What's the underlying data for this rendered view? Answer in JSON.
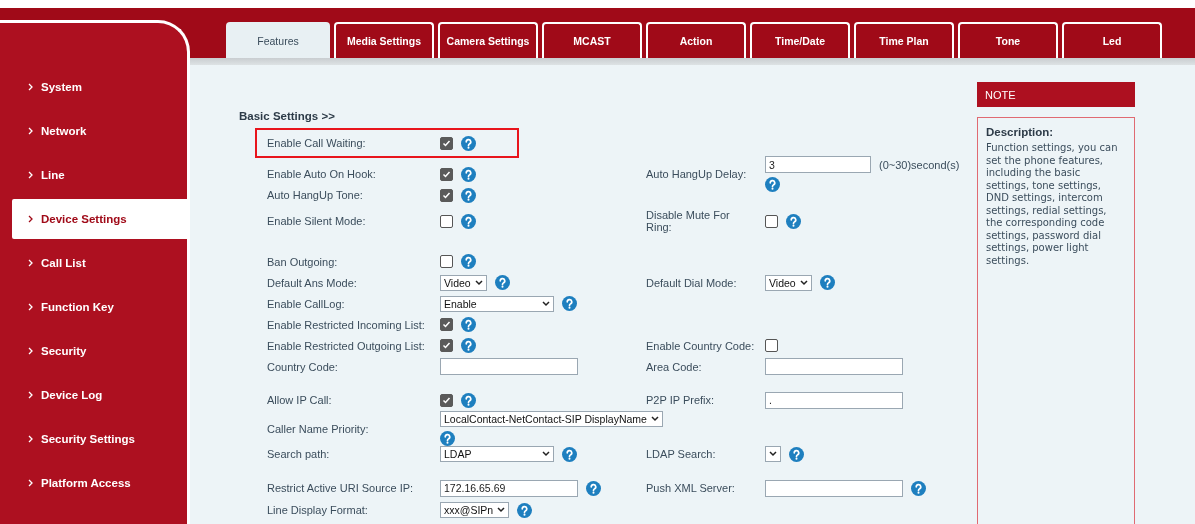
{
  "sidebar": {
    "items": [
      {
        "label": "System",
        "selected": false
      },
      {
        "label": "Network",
        "selected": false
      },
      {
        "label": "Line",
        "selected": false
      },
      {
        "label": "Device Settings",
        "selected": true
      },
      {
        "label": "Call List",
        "selected": false
      },
      {
        "label": "Function Key",
        "selected": false
      },
      {
        "label": "Security",
        "selected": false
      },
      {
        "label": "Device Log",
        "selected": false
      },
      {
        "label": "Security Settings",
        "selected": false
      },
      {
        "label": "Platform Access",
        "selected": false
      }
    ]
  },
  "tabs": [
    {
      "label": "Features",
      "selected": true
    },
    {
      "label": "Media Settings",
      "selected": false
    },
    {
      "label": "Camera Settings",
      "selected": false
    },
    {
      "label": "MCAST",
      "selected": false
    },
    {
      "label": "Action",
      "selected": false
    },
    {
      "label": "Time/Date",
      "selected": false
    },
    {
      "label": "Time Plan",
      "selected": false
    },
    {
      "label": "Tone",
      "selected": false
    },
    {
      "label": "Led",
      "selected": false
    }
  ],
  "section_title": "Basic Settings >>",
  "rows": [
    {
      "highlighted": true,
      "left": {
        "label": "Enable Call Waiting:",
        "kind": "checkbox",
        "checked": true,
        "help": true
      }
    },
    {
      "highlighted": false,
      "left": {
        "label": "Enable Auto On Hook:",
        "kind": "checkbox",
        "checked": true,
        "help": true
      },
      "right": {
        "label": "Auto HangUp Delay:",
        "kind": "input",
        "value": "3",
        "suffix": "(0~30)second(s)",
        "help": true
      }
    },
    {
      "highlighted": false,
      "left": {
        "label": "Auto HangUp Tone:",
        "kind": "checkbox",
        "checked": true,
        "help": true
      }
    },
    {
      "highlighted": false,
      "left": {
        "label": "Enable Silent Mode:",
        "kind": "checkbox",
        "checked": false,
        "help": true
      },
      "right": {
        "label": "Disable Mute For Ring:",
        "kind": "checkbox",
        "checked": false,
        "help": true
      }
    },
    {
      "highlighted": false,
      "left": {
        "label": "Ban Outgoing:",
        "kind": "checkbox",
        "checked": false,
        "help": true
      }
    },
    {
      "highlighted": false,
      "left": {
        "label": "Default Ans Mode:",
        "kind": "dropdown",
        "value": "Video",
        "help": true
      },
      "right": {
        "label": "Default Dial Mode:",
        "kind": "dropdown",
        "value": "Video",
        "help": true
      }
    },
    {
      "highlighted": false,
      "left": {
        "label": "Enable CallLog:",
        "kind": "long-dropdown",
        "value": "Enable",
        "help": true
      }
    },
    {
      "highlighted": false,
      "left": {
        "label": "Enable Restricted Incoming List:",
        "kind": "checkbox",
        "checked": true,
        "help": true
      }
    },
    {
      "highlighted": false,
      "left": {
        "label": "Enable Restricted Outgoing List:",
        "kind": "checkbox",
        "checked": true,
        "help": true
      },
      "right": {
        "label": "Enable Country Code:",
        "kind": "checkbox",
        "checked": false,
        "help": false
      }
    },
    {
      "highlighted": false,
      "left": {
        "label": "Country Code:",
        "kind": "input",
        "help": false
      },
      "right": {
        "label": "Area Code:",
        "kind": "input",
        "help": false
      }
    },
    {
      "highlighted": false,
      "left": {
        "label": "Allow IP Call:",
        "kind": "checkbox",
        "checked": true,
        "help": true
      },
      "right": {
        "label": "P2P IP Prefix:",
        "kind": "input",
        "value": ".",
        "help": false
      }
    },
    {
      "highlighted": false,
      "left": {
        "label": "Caller Name Priority:",
        "kind": "dropdown",
        "value": "LocalContact-NetContact-SIP DisplayName",
        "help": true
      }
    },
    {
      "highlighted": false,
      "left": {
        "label": "Search path:",
        "kind": "long-dropdown",
        "value": "LDAP",
        "help": true
      },
      "right": {
        "label": "LDAP Search:",
        "kind": "dropdown",
        "help": true
      }
    },
    {
      "highlighted": false,
      "left": {
        "label": "Restrict Active URI Source IP:",
        "kind": "input",
        "value": "172.16.65.69",
        "help": true
      },
      "right": {
        "label": "Push XML Server:",
        "kind": "input",
        "help": true
      }
    },
    {
      "highlighted": false,
      "left": {
        "label": "Line Display Format:",
        "kind": "dropdown",
        "value": "xxx@SIPn",
        "help": true
      }
    }
  ],
  "note": {
    "title": "NOTE",
    "heading": "Description:",
    "text": "Function settings, you can set the phone features, including the basic settings, tone settings, DND settings, intercom settings, redial settings, the corresponding code settings, password dial settings, power light settings."
  }
}
